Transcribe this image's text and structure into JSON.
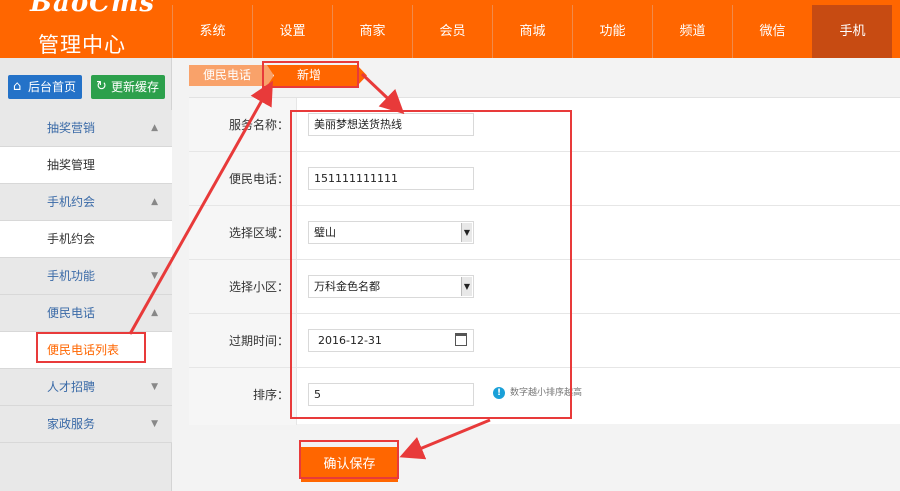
{
  "header": {
    "logo_text": "BaoCms",
    "title": "管理中心",
    "nav": [
      "系统",
      "设置",
      "商家",
      "会员",
      "商城",
      "功能",
      "频道",
      "微信",
      "手机"
    ],
    "active_nav": "手机"
  },
  "sidebar": {
    "home_button": "后台首页",
    "cache_button": "更新缓存",
    "menu": [
      {
        "label": "抽奖营销",
        "type": "group",
        "expanded": true
      },
      {
        "label": "抽奖管理",
        "type": "item"
      },
      {
        "label": "手机约会",
        "type": "group",
        "expanded": true
      },
      {
        "label": "手机约会",
        "type": "item"
      },
      {
        "label": "手机功能",
        "type": "group",
        "expanded": false
      },
      {
        "label": "便民电话",
        "type": "group",
        "expanded": true
      },
      {
        "label": "便民电话列表",
        "type": "item",
        "active": true
      },
      {
        "label": "人才招聘",
        "type": "group",
        "expanded": false
      },
      {
        "label": "家政服务",
        "type": "group",
        "expanded": false
      }
    ]
  },
  "breadcrumb": {
    "parent": "便民电话",
    "current": "新增"
  },
  "form": {
    "service_name": {
      "label": "服务名称：",
      "value": "美丽梦想送货热线"
    },
    "phone": {
      "label": "便民电话：",
      "value": "151111111111"
    },
    "area": {
      "label": "选择区域：",
      "value": "璧山"
    },
    "community": {
      "label": "选择小区：",
      "value": "万科金色名都"
    },
    "expire": {
      "label": "过期时间：",
      "value": "2016-12-31"
    },
    "order": {
      "label": "排序：",
      "value": "5",
      "hint": "数字越小排序越高"
    }
  },
  "save_button": "确认保存",
  "colors": {
    "brand": "#ff6600",
    "nav_active": "#c74b12",
    "annotation": "#e83a3a",
    "group_text": "#3a6aa7"
  }
}
